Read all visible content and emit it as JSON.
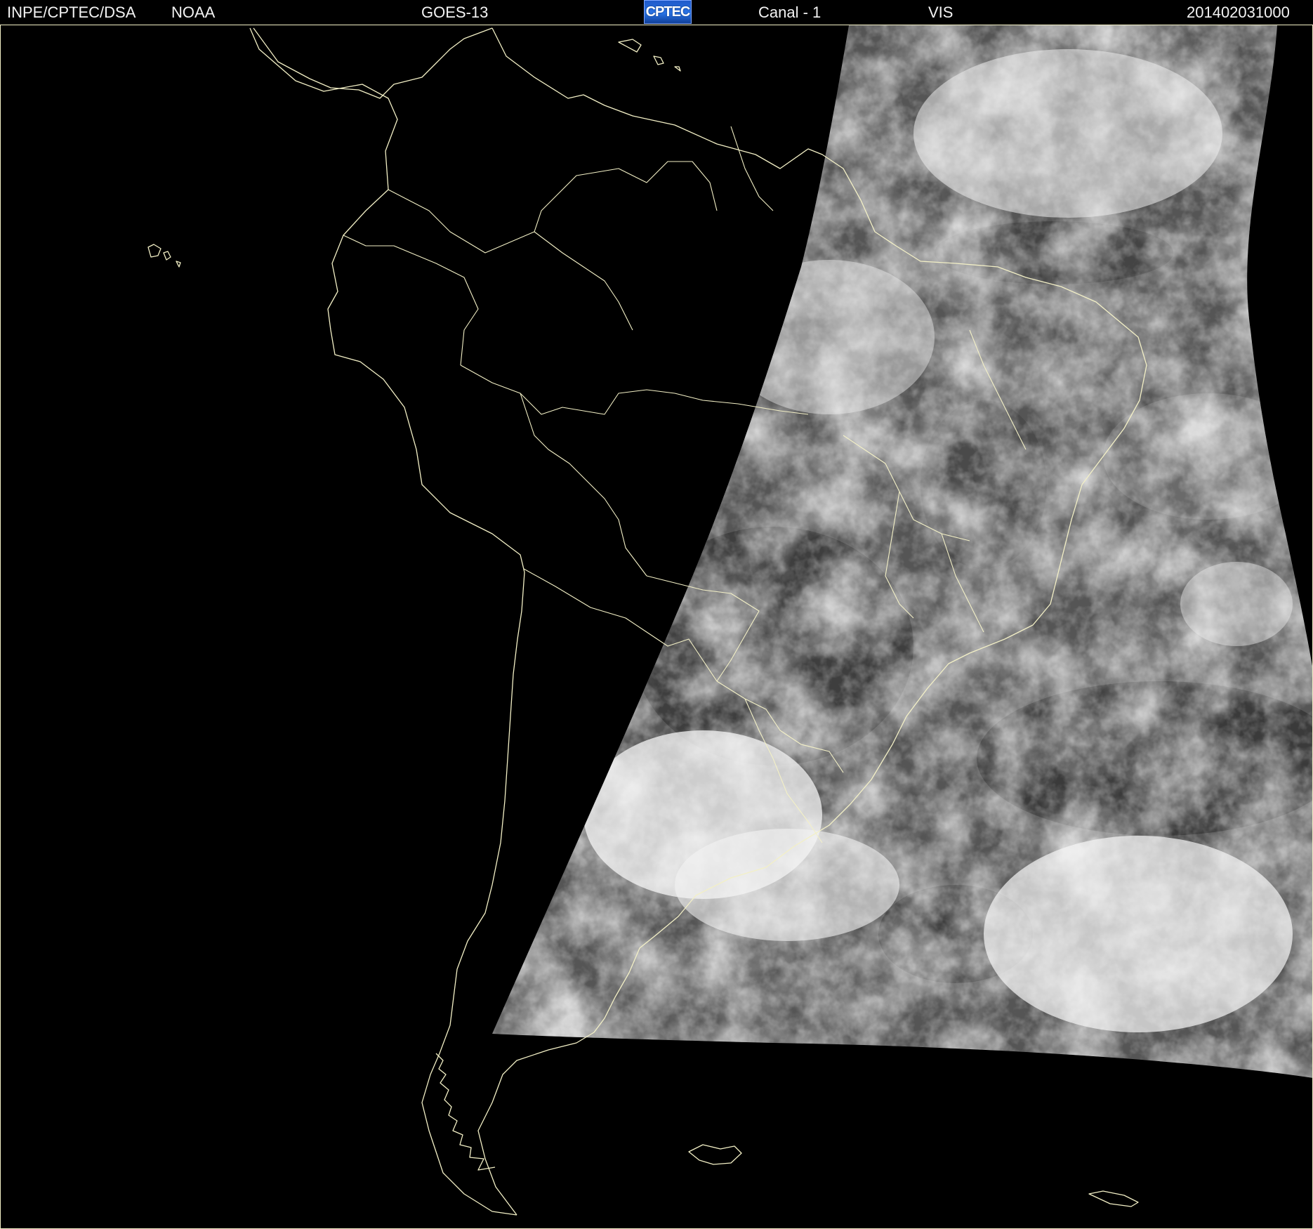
{
  "header": {
    "agency": "INPE/CPTEC/DSA",
    "source": "NOAA",
    "satellite": "GOES-13",
    "logo_text": "CPTEC",
    "channel": "Canal - 1",
    "band": "VIS",
    "timestamp": "201402031000"
  },
  "colors": {
    "background": "#000000",
    "outline": "#f3f0c6",
    "header_text": "#f3f3f3",
    "logo_blue": "#2a74e6"
  },
  "map": {
    "region": "South America",
    "imagery": "visible-channel satellite cloud image"
  }
}
